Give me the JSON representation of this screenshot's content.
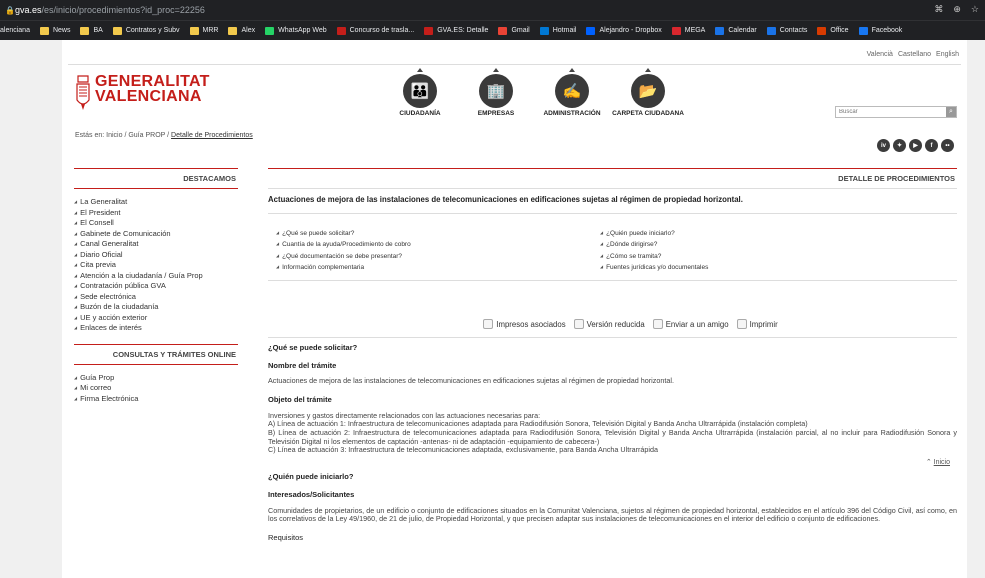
{
  "browser": {
    "domain": "gva.es",
    "path": "/es/inicio/procedimientos?id_proc=22256",
    "bookmarks": [
      {
        "label": "alenciana",
        "color": ""
      },
      {
        "label": "News",
        "color": "#f2c94c"
      },
      {
        "label": "BA",
        "color": "#f2c94c"
      },
      {
        "label": "Contratos y Subv",
        "color": "#f2c94c"
      },
      {
        "label": "MRR",
        "color": "#f2c94c"
      },
      {
        "label": "Alex",
        "color": "#f2c94c"
      },
      {
        "label": "WhatsApp Web",
        "color": "#25d366"
      },
      {
        "label": "Concurso de trasla...",
        "color": "#c41e1a"
      },
      {
        "label": "GVA.ES: Detalle",
        "color": "#c41e1a"
      },
      {
        "label": "Gmail",
        "color": "#ea4335"
      },
      {
        "label": "Hotmail",
        "color": "#0078d4"
      },
      {
        "label": "Alejandro - Dropbox",
        "color": "#0061ff"
      },
      {
        "label": "MEGA",
        "color": "#d9272e"
      },
      {
        "label": "Calendar",
        "color": "#1a73e8"
      },
      {
        "label": "Contacts",
        "color": "#1a73e8"
      },
      {
        "label": "Office",
        "color": "#d83b01"
      },
      {
        "label": "Facebook",
        "color": "#1877f2"
      }
    ]
  },
  "lang": [
    "Valencià",
    "Castellano",
    "English"
  ],
  "logo": {
    "line1": "GENERALITAT",
    "line2": "VALENCIANA"
  },
  "nav": [
    {
      "label": "CIUDADANÍA",
      "glyph": "👪"
    },
    {
      "label": "EMPRESAS",
      "glyph": "🏢"
    },
    {
      "label": "ADMINISTRACIÓN",
      "glyph": "✍"
    },
    {
      "label": "CARPETA CIUDADANA",
      "glyph": "📂"
    }
  ],
  "search": {
    "placeholder": "Buscar"
  },
  "breadcrumb": {
    "prefix": "Estás en:",
    "home": "Inicio",
    "sep": "/",
    "mid": "Guía PROP",
    "current": "Detalle de Procedimientos"
  },
  "social": [
    "tv",
    "tw",
    "yt",
    "f",
    "fl"
  ],
  "sidebar": {
    "destacamos_title": "DESTACAMOS",
    "destacamos": [
      "La Generalitat",
      "El President",
      "El Consell",
      "Gabinete de Comunicación",
      "Canal Generalitat",
      "Diario Oficial",
      "Cita previa",
      "Atención a la ciudadanía / Guía Prop",
      "Contratación pública GVA",
      "Sede electrónica",
      "Buzón de la ciudadanía",
      "UE y acción exterior",
      "Enlaces de interés"
    ],
    "consultas_title": "CONSULTAS Y TRÁMITES ONLINE",
    "consultas": [
      "Guía Prop",
      "Mi correo",
      "Firma Electrónica"
    ]
  },
  "main": {
    "heading": "DETALLE DE PROCEDIMIENTOS",
    "title": "Actuaciones de mejora de las instalaciones de telecomunicaciones en edificaciones sujetas al régimen de propiedad horizontal.",
    "toc_left": [
      "¿Qué se puede solicitar?",
      "Cuantía de la ayuda/Procedimiento de cobro",
      "¿Qué documentación se debe presentar?",
      "Información complementaria"
    ],
    "toc_right": [
      "¿Quién puede iniciarlo?",
      "¿Dónde dirigirse?",
      "¿Cómo se tramita?",
      "Fuentes jurídicas y/o documentales"
    ],
    "tools": [
      "Impresos asociados",
      "Versión reducida",
      "Enviar a un amigo",
      "Imprimir"
    ],
    "q1": "¿Qué se puede solicitar?",
    "nombre_label": "Nombre del trámite",
    "nombre_text": "Actuaciones de mejora de las instalaciones de telecomunicaciones en edificaciones sujetas al régimen de propiedad horizontal.",
    "objeto_label": "Objeto del trámite",
    "objeto_lines": [
      "Inversiones y gastos directamente relacionados con las actuaciones necesarias para:",
      "A) Línea de actuación 1: Infraestructura de telecomunicaciones adaptada para Radiodifusión Sonora, Televisión Digital y Banda Ancha Ultrarrápida (instalación completa)",
      "B) Línea de actuación 2: Infraestructura de telecomunicaciones adaptada para Radiodifusión Sonora, Televisión Digital y Banda Ancha Ultrarrápida (instalación parcial, al no incluir para Radiodifusión Sonora y Televisión Digital ni los elementos de captación -antenas- ni de adaptación -equipamiento de cabecera-)",
      "C) Línea de actuación 3: Infraestructura de telecomunicaciones adaptada, exclusivamente, para Banda Ancha Ultrarrápida"
    ],
    "inicio": "Inicio",
    "q2": "¿Quién puede iniciarlo?",
    "interesados_label": "Interesados/Solicitantes",
    "interesados_text": "Comunidades de propietarios, de un edificio o conjunto de edificaciones situados en la Comunitat Valenciana, sujetos al régimen de propiedad horizontal, establecidos en el artículo 396 del Código Civil, así como, en los correlativos de la Ley 49/1960, de 21 de julio, de Propiedad Horizontal, y que precisen adaptar sus instalaciones de telecomunicaciones en el interior del edificio o conjunto de edificaciones.",
    "requisitos_label": "Requisitos"
  }
}
